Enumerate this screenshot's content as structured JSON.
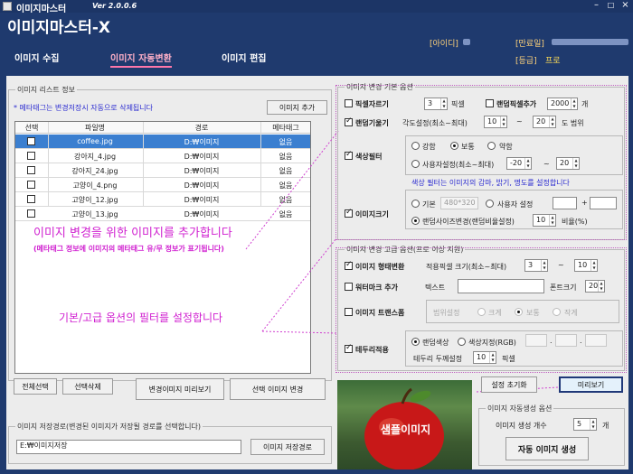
{
  "window": {
    "title": "이미지마스터",
    "version": "Ver 2.0.0.6"
  },
  "header": {
    "app_title": "이미지마스터-X",
    "id_label": "[아이디]",
    "expire_label": "[만료일]",
    "grade_label": "[등급]",
    "grade_value": "프로"
  },
  "nav": {
    "tabs": [
      "이미지 수집",
      "이미지 자동변환",
      "이미지 편집"
    ],
    "active_index": 1
  },
  "image_list": {
    "title": "이미지 리스트 정보",
    "note": "* 메타태그는 변경저장시 자동으로 삭제됩니다",
    "add_button": "이미지 추가",
    "columns": [
      "선택",
      "파일명",
      "경로",
      "메타태그"
    ],
    "rows": [
      {
        "filename": "coffee.jpg",
        "path": "D:₩이미지",
        "meta": "없음",
        "selected": true
      },
      {
        "filename": "강아지_4.jpg",
        "path": "D:₩이미지",
        "meta": "없음"
      },
      {
        "filename": "강아지_24.jpg",
        "path": "D:₩이미지",
        "meta": "없음"
      },
      {
        "filename": "고양이_4.png",
        "path": "D:₩이미지",
        "meta": "없음"
      },
      {
        "filename": "고양이_12.jpg",
        "path": "D:₩이미지",
        "meta": "없음"
      },
      {
        "filename": "고양이_13.jpg",
        "path": "D:₩이미지",
        "meta": "없음"
      }
    ],
    "annotation_1": "이미지 변경을 위한 이미지를 추가합니다",
    "annotation_2": "(메타태그 정보에 이미지의 메타태그 유/무 정보가 표기됩니다)",
    "annotation_3": "기본/고급 옵션의 필터를 설정합니다"
  },
  "list_buttons": {
    "select_all": "전체선택",
    "delete_selected": "선택삭제",
    "preview_changed": "변경이미지 미리보기",
    "change_selected": "선택 이미지 변경"
  },
  "basic_options": {
    "title": "이미지 변경 기본 옵션",
    "pixel_crop_label": "픽셀자르기",
    "pixel_crop_value": "3",
    "pixel_unit": "픽셀",
    "random_pixel_label": "랜덤픽셀추가",
    "random_pixel_value": "2000",
    "count_unit": "개",
    "random_tilt_label": "랜덤기울기",
    "angle_label": "각도설정(최소~최대)",
    "angle_min": "10",
    "angle_max": "20",
    "angle_unit": "도 범위",
    "tilde": "~",
    "color_filter_label": "색상필터",
    "filter_options": [
      "강함",
      "보통",
      "약함"
    ],
    "filter_selected": 1,
    "user_setting_label": "사용자설정(최소~최대)",
    "user_min": "-20",
    "user_max": "20",
    "filter_desc": "색상 필터는 이미지의 감마, 밝기, 명도를 설정합니다",
    "image_size_label": "이미지크기",
    "size_default": "기본",
    "size_default_value": "480*320",
    "size_user": "사용자 설정",
    "size_plus": "+",
    "size_random": "랜덤사이즈변경(랜덤비율설정)",
    "size_ratio_value": "10",
    "size_ratio_unit": "비율(%)"
  },
  "advanced_options": {
    "title": "이미지 변경 고급 옵션(프로 이상 지원)",
    "shape_change_label": "이미지 형태변환",
    "shape_size_label": "적용픽셀 크기(최소~최대)",
    "shape_min": "3",
    "shape_max": "10",
    "watermark_label": "워터마크 추가",
    "text_label": "텍스트",
    "font_size_label": "폰트크기",
    "font_size_value": "20",
    "transparency_label": "이미지 트랜스폼",
    "range_label": "범위설정",
    "range_options": [
      "크게",
      "보통",
      "작게"
    ],
    "border_label": "테두리적용",
    "random_color": "랜덤색상",
    "color_specify": "색상지정(RGB)",
    "border_width_label": "테두리 두께설정",
    "border_width_value": "10",
    "dot": "."
  },
  "preview": {
    "reset_button": "설정 초기화",
    "preview_button": "미리보기",
    "sample_label": "샘플이미지"
  },
  "auto_gen": {
    "title": "이미지 자동생성 옵션",
    "count_label": "이미지 생성 개수",
    "count_value": "5",
    "count_unit": "개",
    "generate_button": "자동 이미지 생성"
  },
  "save_path": {
    "title": "이미지 저장경로(변경된 이미지가 저장될 경로를 선택합니다)",
    "value": "E:₩이미지저장",
    "button": "이미지 저장경로"
  },
  "colors": {
    "accent": "#c020c0",
    "header_bg": "#1f3a6e",
    "selected_row": "#3b7fd0"
  }
}
